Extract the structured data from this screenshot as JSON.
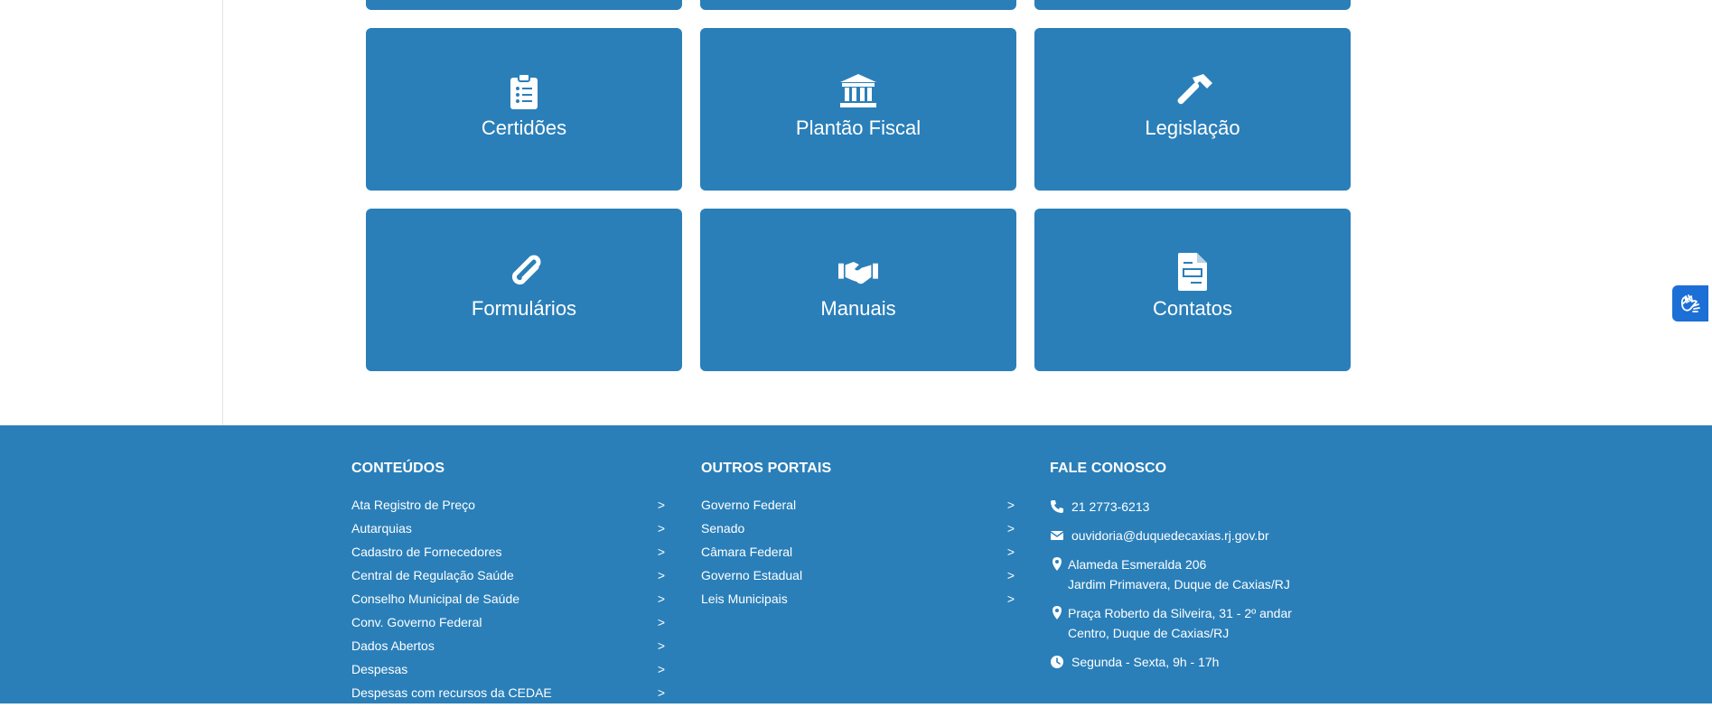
{
  "tiles": [
    {
      "label": "Certidões",
      "icon": "clipboard-list-icon"
    },
    {
      "label": "Plantão Fiscal",
      "icon": "bank-icon"
    },
    {
      "label": "Legislação",
      "icon": "hammer-icon"
    },
    {
      "label": "Formulários",
      "icon": "paperclip-icon"
    },
    {
      "label": "Manuais",
      "icon": "handshake-icon"
    },
    {
      "label": "Contatos",
      "icon": "file-document-icon"
    }
  ],
  "footer": {
    "conteudos": {
      "title": "CONTEÚDOS",
      "items": [
        "Ata Registro de Preço",
        "Autarquias",
        "Cadastro de Fornecedores",
        "Central de Regulação Saúde",
        "Conselho Municipal de Saúde",
        "Conv. Governo Federal",
        "Dados Abertos",
        "Despesas",
        "Despesas com recursos da CEDAE"
      ]
    },
    "outros": {
      "title": "OUTROS PORTAIS",
      "items": [
        "Governo Federal",
        "Senado",
        "Câmara Federal",
        "Governo Estadual",
        "Leis Municipais"
      ]
    },
    "fale": {
      "title": "FALE CONOSCO",
      "phone": "21 2773-6213",
      "email": "ouvidoria@duquedecaxias.rj.gov.br",
      "address1_line1": "Alameda Esmeralda 206",
      "address1_line2": "Jardim Primavera, Duque de Caxias/RJ",
      "address2_line1": "Praça Roberto da Silveira, 31 - 2º andar",
      "address2_line2": "Centro, Duque de Caxias/RJ",
      "hours": "Segunda - Sexta, 9h - 17h"
    },
    "arrow": ">"
  },
  "colors": {
    "primary": "#2a7fb9",
    "accessibility": "#1c6fd6"
  }
}
